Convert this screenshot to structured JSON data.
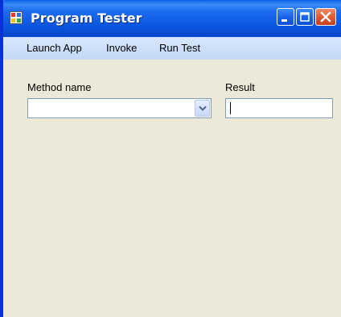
{
  "window": {
    "title": "Program Tester"
  },
  "menu": {
    "items": [
      "Launch App",
      "Invoke",
      "Run Test"
    ]
  },
  "form": {
    "method_label": "Method name",
    "method_value": "",
    "result_label": "Result",
    "result_value": ""
  },
  "colors": {
    "titlebar": "#0a56e0",
    "menubar": "#c3d8f7",
    "client_bg": "#ece9d8",
    "close_button": "#e25a30"
  }
}
